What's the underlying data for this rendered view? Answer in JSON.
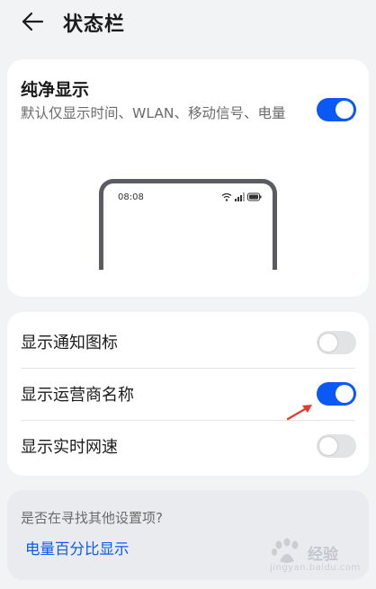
{
  "header": {
    "title": "状态栏",
    "back_icon": "arrow-left-icon"
  },
  "pure_display": {
    "title": "纯净显示",
    "description": "默认仅显示时间、WLAN、移动信号、电量",
    "enabled": true,
    "preview": {
      "time": "08:08",
      "icons": [
        "wifi-icon",
        "signal-icon",
        "battery-icon"
      ]
    }
  },
  "settings": [
    {
      "label": "显示通知图标",
      "enabled": false
    },
    {
      "label": "显示运营商名称",
      "enabled": true
    },
    {
      "label": "显示实时网速",
      "enabled": false
    }
  ],
  "suggestion": {
    "question": "是否在寻找其他设置项?",
    "link": "电量百分比显示"
  },
  "watermark": {
    "text": "经验",
    "sub": "jingyan.baidu.com"
  },
  "colors": {
    "accent": "#0a59f7",
    "background": "#f1f3f5",
    "card": "#ffffff",
    "toggle_off": "#e2e3e5"
  }
}
